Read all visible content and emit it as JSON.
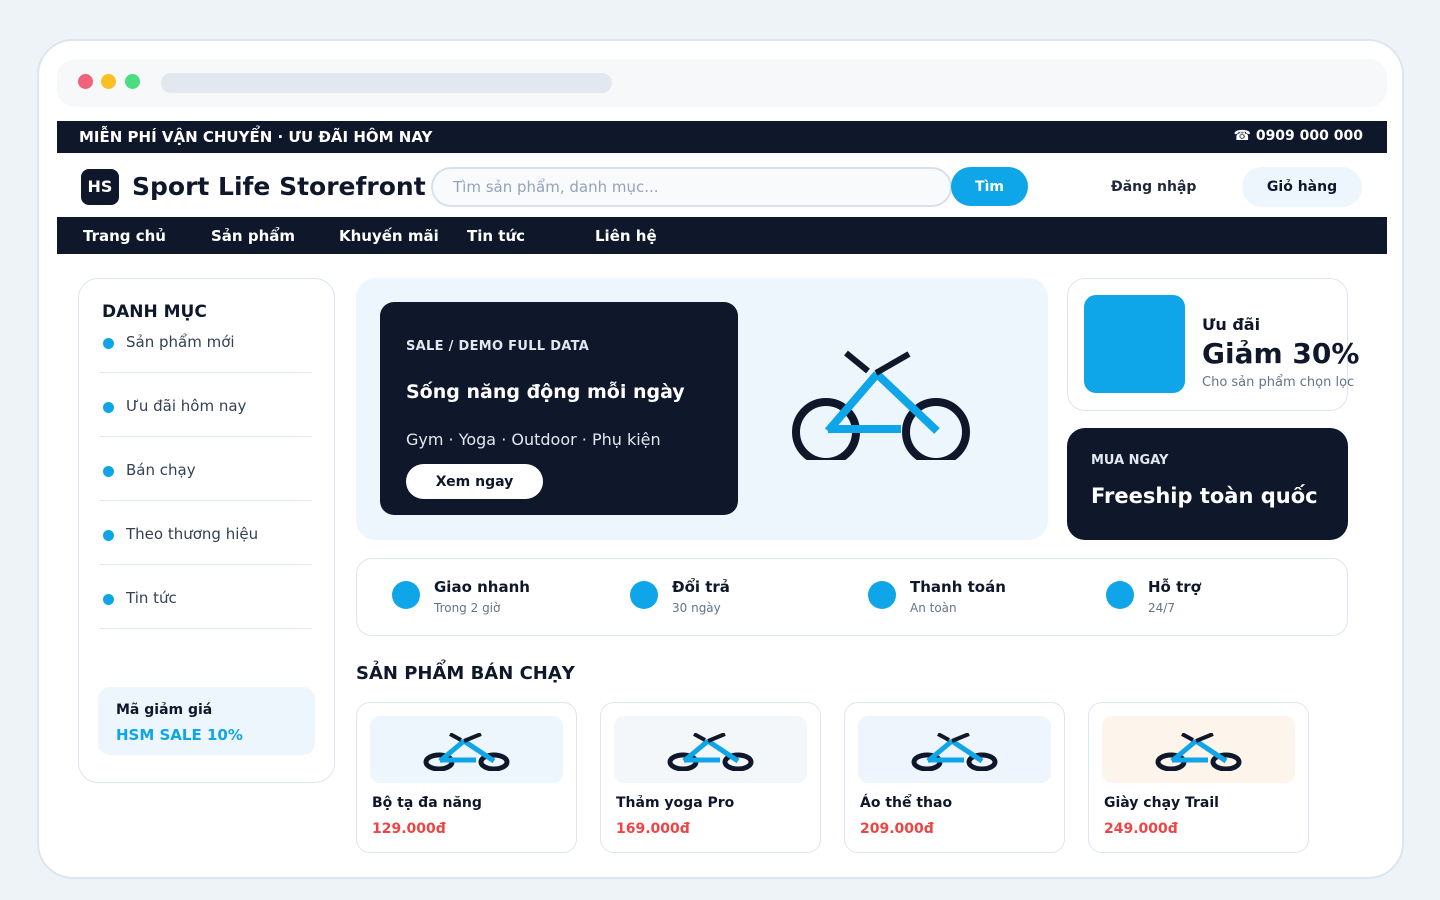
{
  "topbar": {
    "promo": "MIỄN PHÍ VẬN CHUYỂN · ƯU ĐÃI HÔM NAY",
    "phone": "☎ 0909 000 000"
  },
  "header": {
    "logo_badge": "HS",
    "store_name": "Sport Life Storefront",
    "search_placeholder": "Tìm sản phẩm, danh mục...",
    "search_button": "Tìm",
    "login": "Đăng nhập",
    "cart": "Giỏ hàng"
  },
  "nav": {
    "items": [
      {
        "label": "Trang chủ"
      },
      {
        "label": "Sản phẩm"
      },
      {
        "label": "Khuyến mãi"
      },
      {
        "label": "Tin tức"
      },
      {
        "label": "Liên hệ"
      }
    ]
  },
  "sidebar": {
    "title": "DANH MỤC",
    "items": [
      {
        "label": "Sản phẩm mới"
      },
      {
        "label": "Ưu đãi hôm nay"
      },
      {
        "label": "Bán chạy"
      },
      {
        "label": "Theo thương hiệu"
      },
      {
        "label": "Tin tức"
      }
    ],
    "coupon": {
      "title": "Mã giảm giá",
      "code": "HSM SALE 10%"
    }
  },
  "hero": {
    "tag": "SALE / DEMO FULL DATA",
    "title": "Sống năng động mỗi ngày",
    "subtitle": "Gym · Yoga · Outdoor · Phụ kiện",
    "button": "Xem ngay"
  },
  "deal": {
    "label": "Ưu đãi",
    "value": "Giảm 30%",
    "note": "Cho sản phẩm chọn lọc"
  },
  "buy_now": {
    "label": "MUA NGAY",
    "title": "Freeship toàn quốc"
  },
  "features": [
    {
      "title": "Giao nhanh",
      "subtitle": "Trong 2 giờ"
    },
    {
      "title": "Đổi trả",
      "subtitle": "30 ngày"
    },
    {
      "title": "Thanh toán",
      "subtitle": "An toàn"
    },
    {
      "title": "Hỗ trợ",
      "subtitle": "24/7"
    }
  ],
  "bestsellers": {
    "title": "SẢN PHẨM BÁN CHẠY",
    "products": [
      {
        "name": "Bộ tạ đa năng",
        "price": "129.000đ",
        "bg": "#eef6fd"
      },
      {
        "name": "Thảm yoga Pro",
        "price": "169.000đ",
        "bg": "#f4f7fa"
      },
      {
        "name": "Áo thể thao",
        "price": "209.000đ",
        "bg": "#eef5fd"
      },
      {
        "name": "Giày chạy Trail",
        "price": "249.000đ",
        "bg": "#fdf4ec"
      }
    ]
  },
  "colors": {
    "navy": "#0f172a",
    "accent": "#0ea5e9",
    "price": "#ef4444"
  }
}
